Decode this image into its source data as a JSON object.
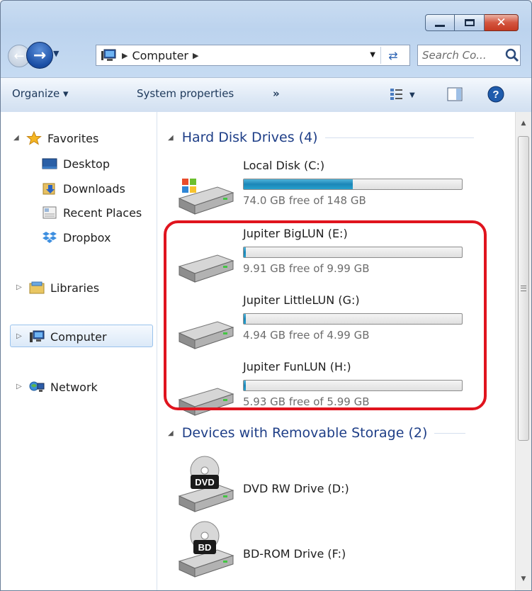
{
  "window": {
    "caption": {
      "minimize": "",
      "maximize": "",
      "close": "✕"
    }
  },
  "nav": {
    "address_segment": "Computer",
    "search_placeholder": "Search Co..."
  },
  "toolbar": {
    "organize_label": "Organize ▾",
    "system_properties_label": "System properties",
    "overflow_label": "»"
  },
  "sidebar": {
    "favorites": {
      "label": "Favorites",
      "items": [
        {
          "label": "Desktop",
          "icon": "desktop-icon"
        },
        {
          "label": "Downloads",
          "icon": "downloads-icon"
        },
        {
          "label": "Recent Places",
          "icon": "recent-places-icon"
        },
        {
          "label": "Dropbox",
          "icon": "dropbox-icon"
        }
      ]
    },
    "libraries": {
      "label": "Libraries"
    },
    "computer": {
      "label": "Computer",
      "selected": true
    },
    "network": {
      "label": "Network"
    }
  },
  "main": {
    "hard_disks_header": "Hard Disk Drives (4)",
    "removable_header": "Devices with Removable Storage (2)",
    "drives": [
      {
        "name": "Local Disk (C:)",
        "free_text": "74.0 GB free of 148 GB",
        "used_fraction": 0.5
      },
      {
        "name": "Jupiter BigLUN (E:)",
        "free_text": "9.91 GB free of 9.99 GB",
        "used_fraction": 0.01
      },
      {
        "name": "Jupiter LittleLUN (G:)",
        "free_text": "4.94 GB free of 4.99 GB",
        "used_fraction": 0.01
      },
      {
        "name": "Jupiter FunLUN (H:)",
        "free_text": "5.93 GB free of 5.99 GB",
        "used_fraction": 0.01
      }
    ],
    "removable": [
      {
        "name": "DVD RW Drive (D:)",
        "badge": "DVD"
      },
      {
        "name": "BD-ROM Drive (F:)",
        "badge": "BD"
      }
    ]
  },
  "colors": {
    "accent": "#1e3e87",
    "highlight": "#e0141e",
    "bar_fill": "#1b86b8"
  }
}
